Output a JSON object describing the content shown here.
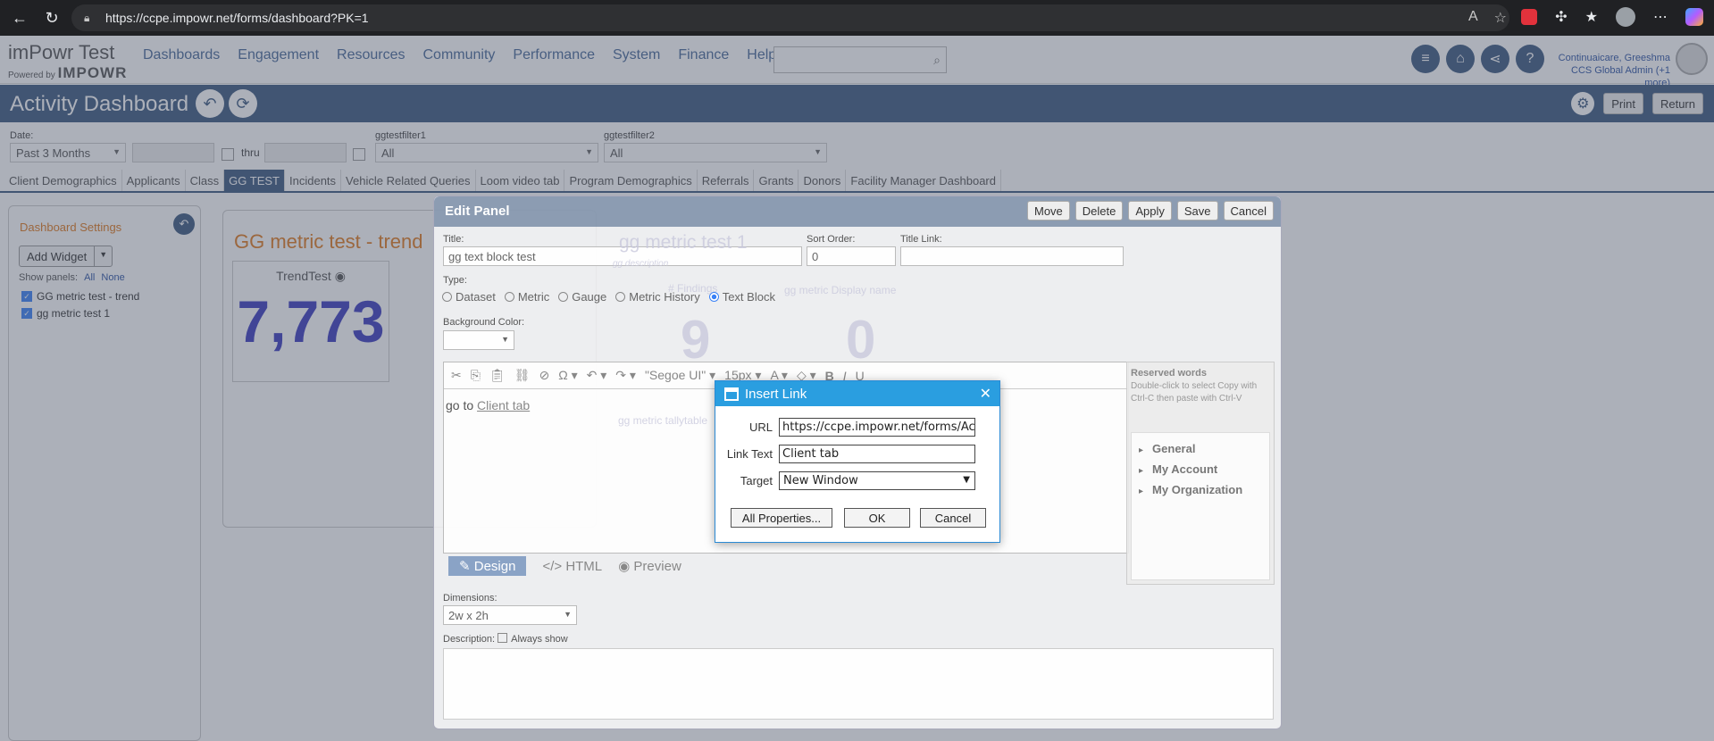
{
  "browser": {
    "url": "https://ccpe.impowr.net/forms/dashboard?PK=1"
  },
  "header": {
    "logo_title": "imPowr Test",
    "logo_sub_prefix": "Powered by",
    "logo_sub_brand": "IMPOWR",
    "menu": [
      "Dashboards",
      "Engagement",
      "Resources",
      "Community",
      "Performance",
      "System",
      "Finance",
      "Help"
    ],
    "user_name": "Continuaicare, Greeshma",
    "user_role": "CCS Global Admin (+1 more)"
  },
  "titlebar": {
    "title": "Activity Dashboard",
    "print_label": "Print",
    "return_label": "Return"
  },
  "filters": {
    "date_label": "Date:",
    "date_value": "Past 3 Months",
    "thru_label": "thru",
    "filter1_label": "ggtestfilter1",
    "filter1_value": "All",
    "filter2_label": "ggtestfilter2",
    "filter2_value": "All"
  },
  "tabs": [
    "Client Demographics",
    "Applicants",
    "Class",
    "GG TEST",
    "Incidents",
    "Vehicle Related Queries",
    "Loom video tab",
    "Program Demographics",
    "Referrals",
    "Grants",
    "Donors",
    "Facility Manager Dashboard"
  ],
  "left_panel": {
    "title": "Dashboard Settings",
    "add_widget": "Add Widget",
    "show_panels_label": "Show panels:",
    "all_label": "All",
    "none_label": "None",
    "panels": [
      "GG metric test - trend",
      "gg metric test 1"
    ]
  },
  "widget": {
    "title": "GG metric test - trend",
    "card_label": "TrendTest",
    "card_value": "7,773"
  },
  "edit_panel": {
    "title": "Edit Panel",
    "buttons": [
      "Move",
      "Delete",
      "Apply",
      "Save",
      "Cancel"
    ],
    "title_label": "Title:",
    "title_value": "gg text block test",
    "sort_label": "Sort Order:",
    "sort_value": "0",
    "title_link_label": "Title Link:",
    "type_label": "Type:",
    "types": [
      "Dataset",
      "Metric",
      "Gauge",
      "Metric History",
      "Text Block"
    ],
    "bg_label": "Background Color:",
    "font_name": "\"Segoe UI\"",
    "font_size": "15px",
    "editor_text": "go to",
    "editor_link": "Client tab",
    "reserved_title": "Reserved words",
    "reserved_desc": "Double-click to select Copy with Ctrl-C then paste with Ctrl-V",
    "reserved_items": [
      "General",
      "My Account",
      "My Organization"
    ],
    "mode_tabs": [
      "Design",
      "HTML",
      "Preview"
    ],
    "dimensions_label": "Dimensions:",
    "dimensions_value": "2w x 2h",
    "description_label": "Description:",
    "always_show": "Always show"
  },
  "ghost_widget": {
    "title": "gg metric test 1",
    "desc": "gg description",
    "findings_label": "# Findings",
    "findings_value": "9",
    "display_label": "gg metric Display name",
    "display_value": "0",
    "tally_label": "gg metric tallytable"
  },
  "dialog": {
    "title": "Insert Link",
    "url_label": "URL",
    "url_value": "https://ccpe.impowr.net/forms/Accou",
    "text_label": "Link Text",
    "text_value": "Client tab",
    "target_label": "Target",
    "target_value": "New Window",
    "all_props": "All Properties...",
    "ok": "OK",
    "cancel": "Cancel"
  }
}
